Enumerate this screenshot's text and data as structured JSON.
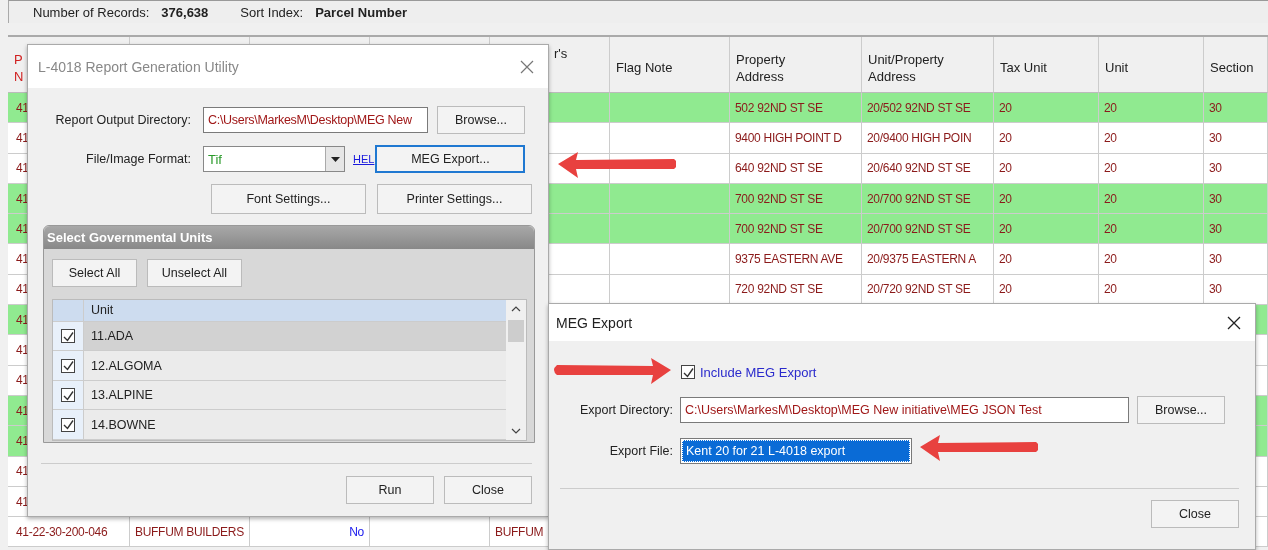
{
  "summary": {
    "records_label": "Number of Records:",
    "records": "376,638",
    "sort_label": "Sort Index:",
    "sort": "Parcel Number"
  },
  "records_table": {
    "columns": [
      "P\nN",
      null,
      null,
      null,
      "r's",
      "Flag Note",
      "Property\nAddress",
      "Unit/Property\nAddress",
      "Tax Unit",
      "Unit",
      "Section"
    ],
    "rows": [
      {
        "highlighted": true,
        "cells": [
          "41",
          null,
          null,
          null,
          null,
          null,
          "502 92ND ST SE",
          "20/502 92ND ST SE",
          "20",
          "20",
          "30"
        ]
      },
      {
        "highlighted": false,
        "cells": [
          "41",
          null,
          null,
          null,
          null,
          null,
          "9400 HIGH POINT D",
          "20/9400 HIGH POIN",
          "20",
          "20",
          "30"
        ]
      },
      {
        "highlighted": false,
        "cells": [
          "41",
          null,
          null,
          null,
          null,
          null,
          "640 92ND ST SE",
          "20/640 92ND ST SE",
          "20",
          "20",
          "30"
        ]
      },
      {
        "highlighted": true,
        "cells": [
          "41",
          null,
          null,
          null,
          null,
          null,
          "700 92ND ST SE",
          "20/700 92ND ST SE",
          "20",
          "20",
          "30"
        ]
      },
      {
        "highlighted": true,
        "cells": [
          "41",
          null,
          null,
          null,
          null,
          null,
          "700 92ND ST SE",
          "20/700 92ND ST SE",
          "20",
          "20",
          "30"
        ]
      },
      {
        "highlighted": false,
        "cells": [
          "41",
          null,
          null,
          null,
          null,
          null,
          "9375 EASTERN AVE",
          "20/9375 EASTERN A",
          "20",
          "20",
          "30"
        ]
      },
      {
        "highlighted": false,
        "cells": [
          "41",
          null,
          null,
          null,
          null,
          null,
          "720 92ND ST SE",
          "20/720 92ND ST SE",
          "20",
          "20",
          "30"
        ]
      },
      {
        "highlighted": true,
        "cells": [
          "41",
          null,
          null,
          null,
          null,
          null,
          null,
          null,
          null,
          null,
          null
        ]
      },
      {
        "highlighted": false,
        "cells": [
          "41",
          null,
          null,
          null,
          null,
          null,
          null,
          null,
          null,
          null,
          null
        ]
      },
      {
        "highlighted": false,
        "cells": [
          "41",
          null,
          null,
          null,
          null,
          null,
          null,
          null,
          null,
          null,
          null
        ]
      },
      {
        "highlighted": true,
        "cells": [
          "41",
          null,
          null,
          null,
          null,
          null,
          null,
          null,
          null,
          null,
          null
        ]
      },
      {
        "highlighted": true,
        "cells": [
          "41",
          null,
          null,
          null,
          null,
          null,
          null,
          null,
          null,
          null,
          null
        ]
      },
      {
        "highlighted": false,
        "cells": [
          "41",
          null,
          null,
          null,
          null,
          null,
          null,
          null,
          null,
          null,
          null
        ]
      },
      {
        "highlighted": false,
        "cells": [
          "41",
          null,
          null,
          null,
          null,
          null,
          null,
          null,
          null,
          null,
          null
        ]
      },
      {
        "highlighted": false,
        "cells": [
          "41-22-30-200-046",
          "BUFFUM BUILDERS",
          "No",
          null,
          "BUFFUM",
          null,
          null,
          null,
          null,
          null,
          null
        ]
      }
    ]
  },
  "report_dialog": {
    "title": "L-4018 Report Generation Utility",
    "output_directory": {
      "label": "Report Output Directory:",
      "value": "C:\\Users\\MarkesM\\Desktop\\MEG New",
      "button": "Browse..."
    },
    "format": {
      "label": "File/Image Format:",
      "value": "Tif",
      "help_link": "HEL",
      "button": "MEG Export...",
      "button_focused": true
    },
    "settings_buttons": [
      "Font Settings...",
      "Printer Settings..."
    ],
    "units_group": {
      "title": "Select Governmental Units",
      "buttons": [
        "Select All",
        "Unselect All"
      ],
      "column": "Unit",
      "units": [
        {
          "label": "11.ADA",
          "checked": true,
          "selected": true
        },
        {
          "label": "12.ALGOMA",
          "checked": true,
          "selected": false
        },
        {
          "label": "13.ALPINE",
          "checked": true,
          "selected": false
        },
        {
          "label": "14.BOWNE",
          "checked": true,
          "selected": false
        }
      ]
    },
    "buttons": [
      "Run",
      "Close"
    ]
  },
  "meg_dialog": {
    "title": "MEG Export",
    "include": {
      "label": "Include MEG Export",
      "checked": true
    },
    "export_directory": {
      "label": "Export Directory:",
      "value": "C:\\Users\\MarkesM\\Desktop\\MEG New initiative\\MEG JSON Test",
      "button": "Browse..."
    },
    "export_file": {
      "label": "Export File:",
      "value": "Kent 20 for 21 L-4018 export",
      "text_selected": true
    },
    "buttons": [
      "Close"
    ]
  },
  "callouts": [
    {
      "kind": "arrow_left"
    },
    {
      "kind": "arrow_right"
    },
    {
      "kind": "arrow_left"
    }
  ]
}
